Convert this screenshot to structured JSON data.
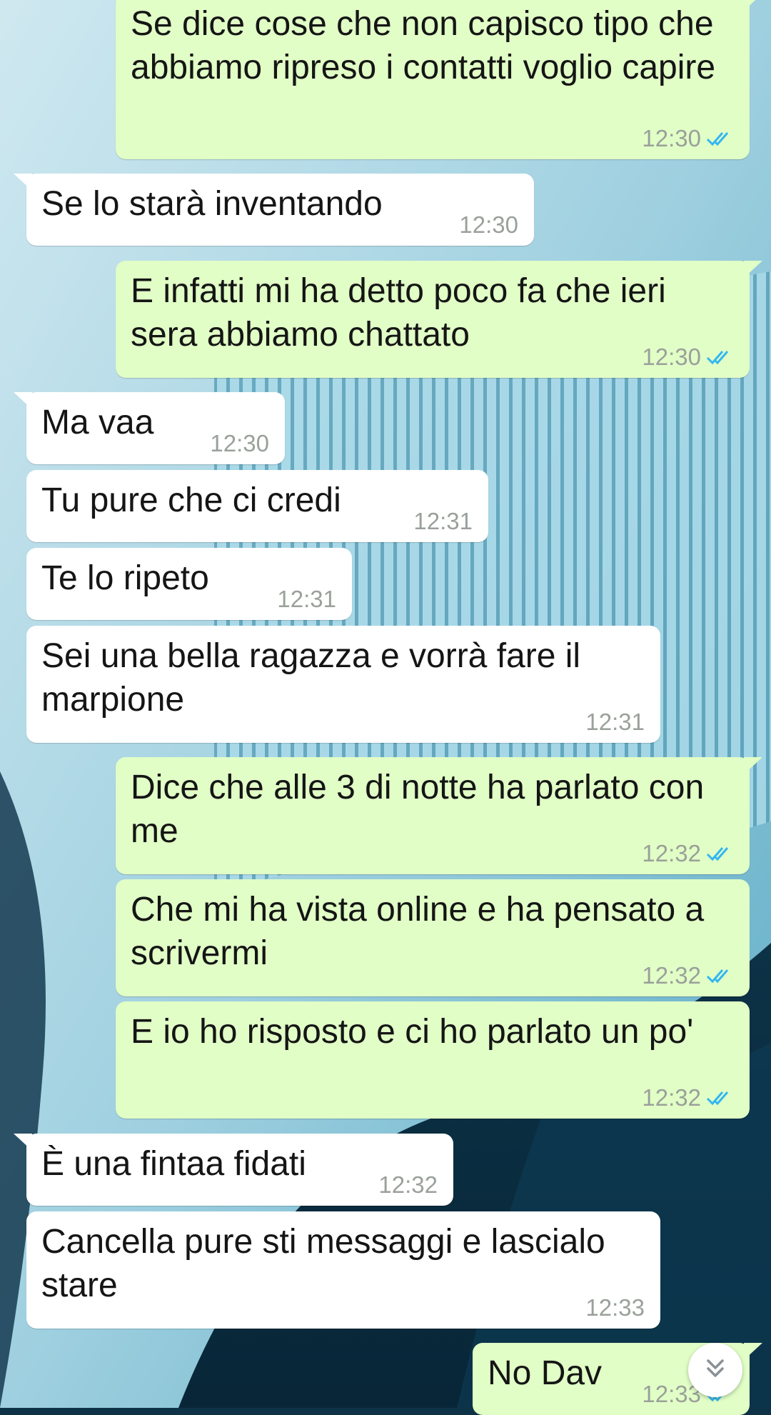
{
  "messages": [
    {
      "dir": "out",
      "text": "Se dice cose che non capisco tipo che abbiamo ripreso i contatti voglio capire",
      "time": "12:30",
      "status": "read"
    },
    {
      "dir": "in",
      "text": "Se lo starà inventando",
      "time": "12:30"
    },
    {
      "dir": "out",
      "text": "E infatti mi ha detto poco fa che ieri sera abbiamo chattato",
      "time": "12:30",
      "status": "read"
    },
    {
      "dir": "in",
      "text": "Ma vaa",
      "time": "12:30"
    },
    {
      "dir": "in",
      "text": "Tu pure che ci credi",
      "time": "12:31"
    },
    {
      "dir": "in",
      "text": "Te lo ripeto",
      "time": "12:31"
    },
    {
      "dir": "in",
      "text": "Sei una bella ragazza e vorrà fare il marpione",
      "time": "12:31"
    },
    {
      "dir": "out",
      "text": "Dice che alle 3 di notte ha parlato con me",
      "time": "12:32",
      "status": "read"
    },
    {
      "dir": "out",
      "text": "Che mi ha vista online e ha pensato a scrivermi",
      "time": "12:32",
      "status": "read"
    },
    {
      "dir": "out",
      "text": "E io ho risposto e ci ho parlato un po'",
      "time": "12:32",
      "status": "read"
    },
    {
      "dir": "in",
      "text": "È una fintaa fidati",
      "time": "12:32"
    },
    {
      "dir": "in",
      "text": "Cancella pure sti messaggi e lascialo stare",
      "time": "12:33"
    },
    {
      "dir": "out",
      "text": "No Dav",
      "time": "12:33",
      "status": "read"
    }
  ],
  "colors": {
    "incoming_bubble": "#ffffff",
    "outgoing_bubble": "#e1fec6",
    "read_tick": "#34b7f1",
    "timestamp": "#9aa09a"
  },
  "icons": {
    "read_receipt": "double-check-icon",
    "scroll_down": "chevron-double-down-icon"
  }
}
